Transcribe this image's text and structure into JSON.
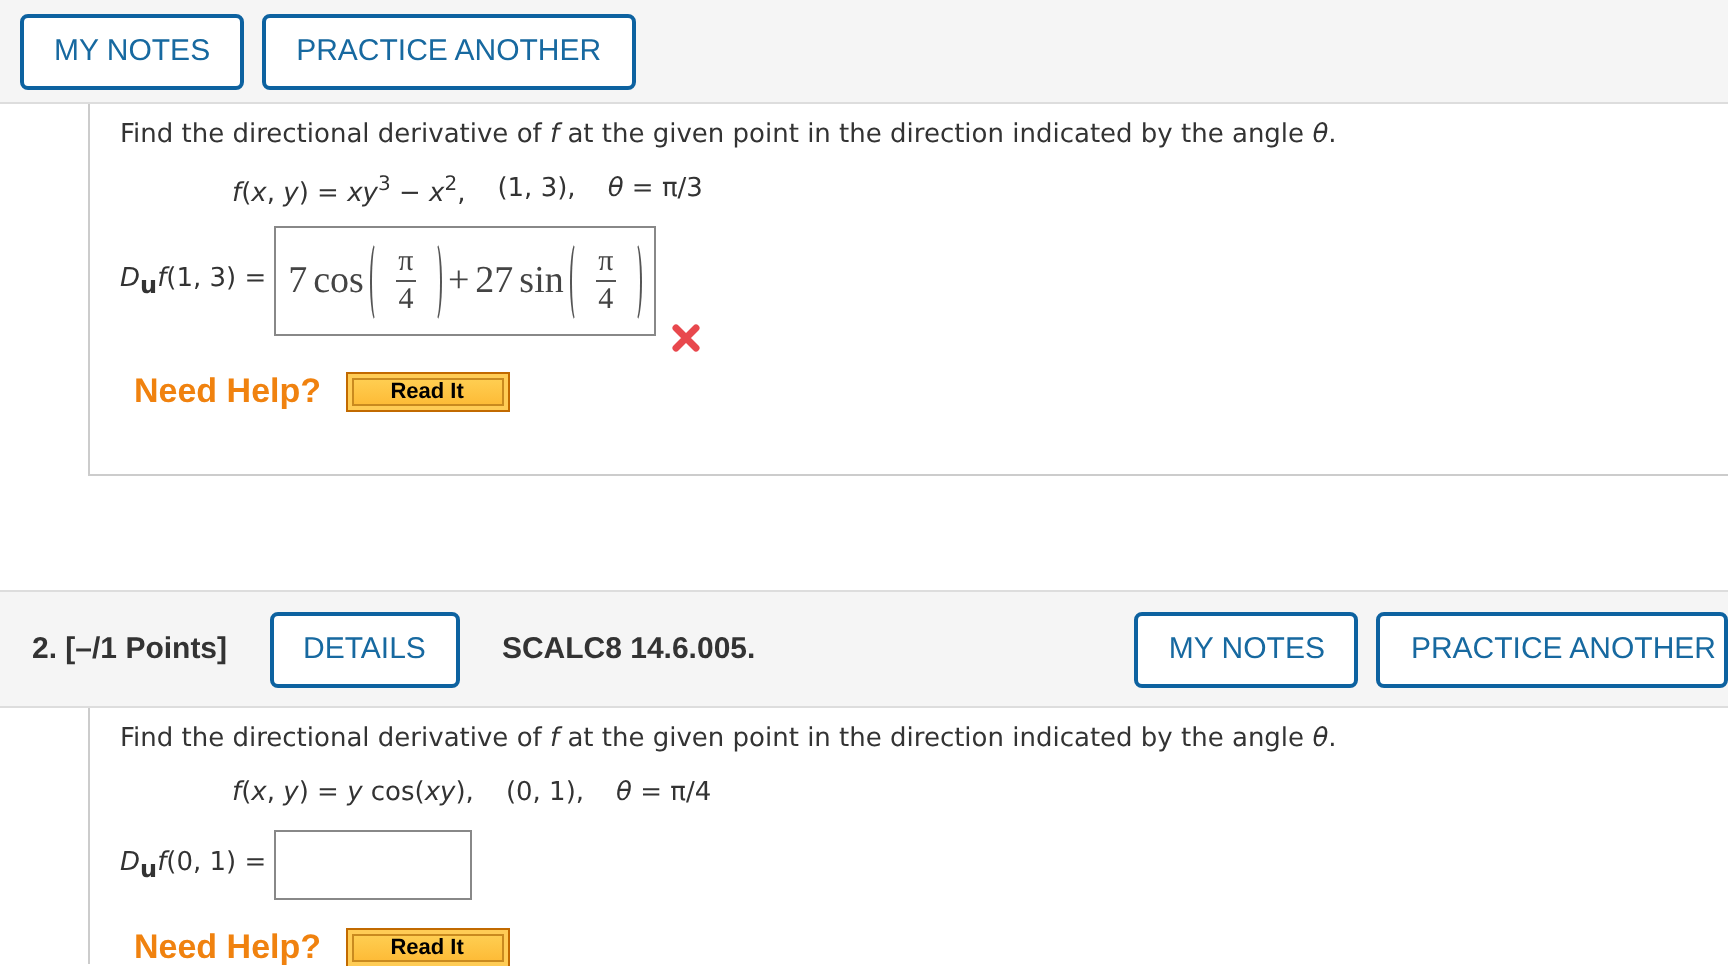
{
  "question_1_toolbar": {
    "buttons": [
      "MY NOTES",
      "PRACTICE ANOTHER"
    ]
  },
  "question_1": {
    "prompt": "Find the directional derivative of *f* at the given point in the direction indicated by the angle *θ*.",
    "function": "*f*(*x*, *y*) = *xy*$^{3}$ − *x*$^{2}$,",
    "point": "(1, 3),",
    "angle": "*θ* = π/3",
    "answer_label": "*D*$_{u}$*f*(1, 3) =",
    "answer": {
      "correct": false,
      "terms": [
        {
          "coef": "7",
          "func": "cos",
          "num": "π",
          "den": "4"
        },
        {
          "op": "+",
          "coef": "27",
          "func": "sin",
          "num": "π",
          "den": "4"
        }
      ]
    },
    "help_label": "Need Help?",
    "help_button": "Read It"
  },
  "question_2_header": {
    "number": "2. [–/1 Points]",
    "details_button": "DETAILS",
    "source": "SCALC8 14.6.005.",
    "buttons": [
      "MY NOTES",
      "PRACTICE ANOTHER"
    ]
  },
  "question_2": {
    "prompt": "Find the directional derivative of *f* at the given point in the direction indicated by the angle *θ*.",
    "function": "*f*(*x*, *y*) = *y* cos(*xy*),",
    "point": "(0, 1),",
    "angle": "*θ* = π/4",
    "answer_label": "*D*$_{u}$*f*(0, 1) =",
    "help_label": "Need Help?",
    "help_button": "Read It"
  }
}
